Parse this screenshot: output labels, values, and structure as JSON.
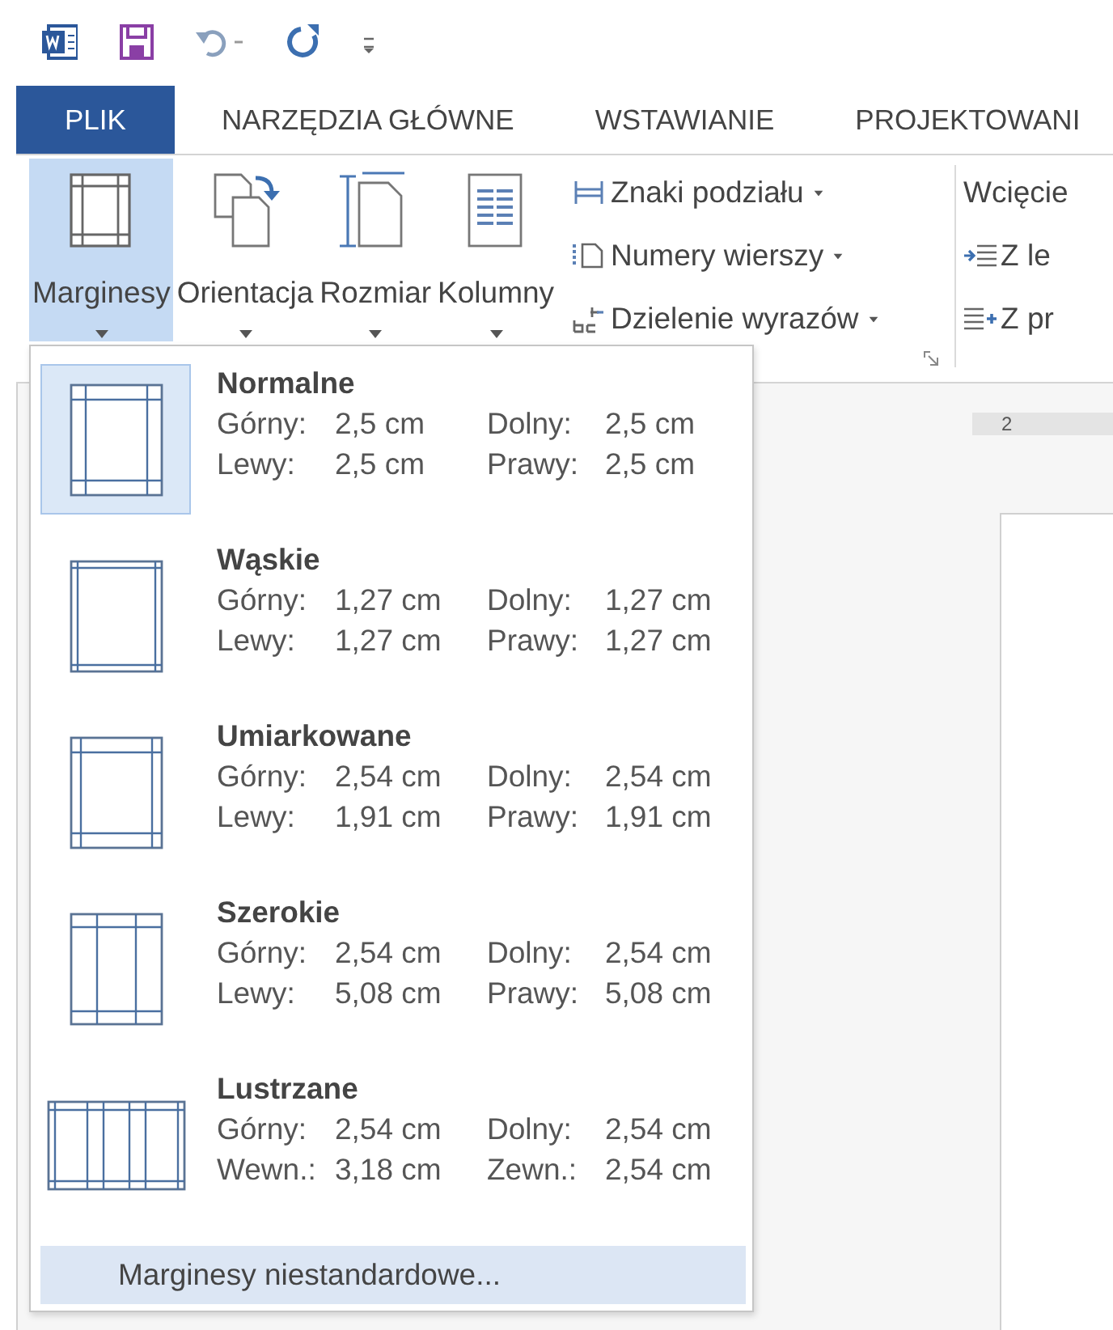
{
  "tabs": [
    {
      "label": "PLIK",
      "kind": "file",
      "selected": false
    },
    {
      "label": "NARZĘDZIA GŁÓWNE",
      "kind": "tab",
      "selected": false
    },
    {
      "label": "WSTAWIANIE",
      "kind": "tab",
      "selected": false
    },
    {
      "label": "PROJEKTOWANI",
      "kind": "tab",
      "selected": false
    }
  ],
  "ribbon": {
    "large_buttons": [
      {
        "label": "Marginesy",
        "kind": "margins",
        "pressed": true
      },
      {
        "label": "Orientacja",
        "kind": "orientation",
        "pressed": false
      },
      {
        "label": "Rozmiar",
        "kind": "size",
        "pressed": false
      },
      {
        "label": "Kolumny",
        "kind": "columns",
        "pressed": false
      }
    ],
    "small_buttons": [
      {
        "label": "Znaki podziału",
        "kind": "breaks"
      },
      {
        "label": "Numery wierszy",
        "kind": "line_numbers"
      },
      {
        "label": "Dzielenie wyrazów",
        "kind": "hyphenation"
      }
    ],
    "indent_group": {
      "title": "Wcięcie",
      "buttons": [
        {
          "label": "Z le",
          "kind": "left"
        },
        {
          "label": "Z pr",
          "kind": "right"
        }
      ]
    }
  },
  "ruler": {
    "label": "2"
  },
  "margins_menu": {
    "presets": [
      {
        "name": "Normalne",
        "kind": "normal",
        "selected": true,
        "rows": [
          [
            {
              "label": "Górny:",
              "value": "2,5 cm"
            },
            {
              "label": "Dolny:",
              "value": "2,5 cm"
            }
          ],
          [
            {
              "label": "Lewy:",
              "value": "2,5 cm"
            },
            {
              "label": "Prawy:",
              "value": "2,5 cm"
            }
          ]
        ]
      },
      {
        "name": "Wąskie",
        "kind": "narrow",
        "selected": false,
        "rows": [
          [
            {
              "label": "Górny:",
              "value": "1,27 cm"
            },
            {
              "label": "Dolny:",
              "value": "1,27 cm"
            }
          ],
          [
            {
              "label": "Lewy:",
              "value": "1,27 cm"
            },
            {
              "label": "Prawy:",
              "value": "1,27 cm"
            }
          ]
        ]
      },
      {
        "name": "Umiarkowane",
        "kind": "moderate",
        "selected": false,
        "rows": [
          [
            {
              "label": "Górny:",
              "value": "2,54 cm"
            },
            {
              "label": "Dolny:",
              "value": "2,54 cm"
            }
          ],
          [
            {
              "label": "Lewy:",
              "value": "1,91 cm"
            },
            {
              "label": "Prawy:",
              "value": "1,91 cm"
            }
          ]
        ]
      },
      {
        "name": "Szerokie",
        "kind": "wide",
        "selected": false,
        "rows": [
          [
            {
              "label": "Górny:",
              "value": "2,54 cm"
            },
            {
              "label": "Dolny:",
              "value": "2,54 cm"
            }
          ],
          [
            {
              "label": "Lewy:",
              "value": "5,08 cm"
            },
            {
              "label": "Prawy:",
              "value": "5,08 cm"
            }
          ]
        ]
      },
      {
        "name": "Lustrzane",
        "kind": "mirrored",
        "selected": false,
        "rows": [
          [
            {
              "label": "Górny:",
              "value": "2,54 cm"
            },
            {
              "label": "Dolny:",
              "value": "2,54 cm"
            }
          ],
          [
            {
              "label": "Wewn.:",
              "value": "3,18 cm"
            },
            {
              "label": "Zewn.:",
              "value": "2,54 cm"
            }
          ]
        ]
      }
    ],
    "custom": {
      "label": "Marginesy niestandardowe...",
      "highlighted": true
    }
  }
}
